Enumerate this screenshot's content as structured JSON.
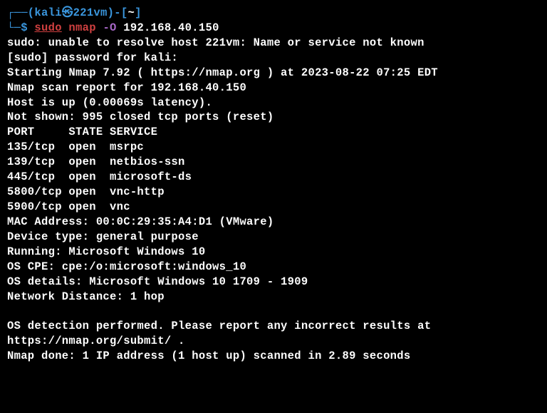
{
  "prompt": {
    "top_line": {
      "corner": "┌──(",
      "user": "kali",
      "symbol": "㉿",
      "host": "221vm",
      "close": ")-[",
      "path": "~",
      "end": "]"
    },
    "cmd_line": {
      "corner": "└─",
      "dollar": "$ ",
      "sudo": "sudo",
      "space1": " ",
      "cmd": "nmap",
      "space2": " ",
      "flag": "-O",
      "space3": " ",
      "target": "192.168.40.150"
    }
  },
  "out": {
    "l0": "sudo: unable to resolve host 221vm: Name or service not known",
    "l1": "[sudo] password for kali:",
    "l2": "Starting Nmap 7.92 ( https://nmap.org ) at 2023-08-22 07:25 EDT",
    "l3": "Nmap scan report for 192.168.40.150",
    "l4": "Host is up (0.00069s latency).",
    "l5": "Not shown: 995 closed tcp ports (reset)",
    "hdr": "PORT     STATE SERVICE",
    "r0": "135/tcp  open  msrpc",
    "r1": "139/tcp  open  netbios-ssn",
    "r2": "445/tcp  open  microsoft-ds",
    "r3": "5800/tcp open  vnc-http",
    "r4": "5900/tcp open  vnc",
    "l6": "MAC Address: 00:0C:29:35:A4:D1 (VMware)",
    "l7": "Device type: general purpose",
    "l8": "Running: Microsoft Windows 10",
    "l9": "OS CPE: cpe:/o:microsoft:windows_10",
    "l10": "OS details: Microsoft Windows 10 1709 - 1909",
    "l11": "Network Distance: 1 hop",
    "l12": "OS detection performed. Please report any incorrect results at https://nmap.org/submit/ .",
    "l13": "Nmap done: 1 IP address (1 host up) scanned in 2.89 seconds"
  }
}
